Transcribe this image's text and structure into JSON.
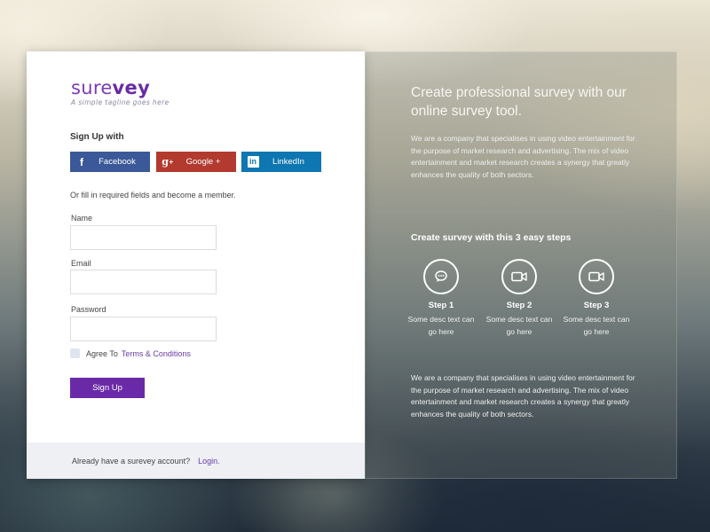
{
  "brand": {
    "logo_part1": "sure",
    "logo_part2": "vey",
    "tagline": "A simple tagline goes here"
  },
  "signup": {
    "heading": "Sign Up with",
    "social": [
      {
        "label": "Facebook",
        "icon": "facebook-icon",
        "color": "#3b5998"
      },
      {
        "label": "Google +",
        "icon": "google-plus-icon",
        "color": "#b23a2f"
      },
      {
        "label": "LinkedIn",
        "icon": "linkedin-icon",
        "color": "#0e76b0"
      }
    ],
    "note": "Or fill in required fields and become a member.",
    "fields": {
      "name_label": "Name",
      "name_value": "",
      "email_label": "Email",
      "email_value": "",
      "password_label": "Password",
      "password_value": ""
    },
    "agree_prefix": "Agree To",
    "terms_link": "Terms & Conditions",
    "submit_label": "Sign Up"
  },
  "footer": {
    "text": "Already have a surevey account?",
    "login_link": "Login."
  },
  "promo": {
    "title": "Create professional survey with our online survey tool.",
    "paragraph1": "We are a company that specialises in using video entertainment for the purpose of market research and advertising. The mix of video entertainment and market research creates a synergy that greatly enhances the quality of both sectors.",
    "steps_heading": "Create survey with this 3 easy steps",
    "steps": [
      {
        "title": "Step 1",
        "desc": "Some desc text can go here",
        "icon": "chat-bubble-icon"
      },
      {
        "title": "Step 2",
        "desc": "Some desc text can go here",
        "icon": "video-camera-icon"
      },
      {
        "title": "Step 3",
        "desc": "Some desc text can go here",
        "icon": "video-camera-icon"
      }
    ],
    "paragraph2": "We are a company that specialises in using video entertainment for the purpose of market research and advertising. The mix of video entertainment and market research creates a synergy that greatly enhances the quality of both sectors."
  },
  "colors": {
    "brand_purple": "#6a2aa8",
    "link_purple": "#6a3aa8"
  }
}
